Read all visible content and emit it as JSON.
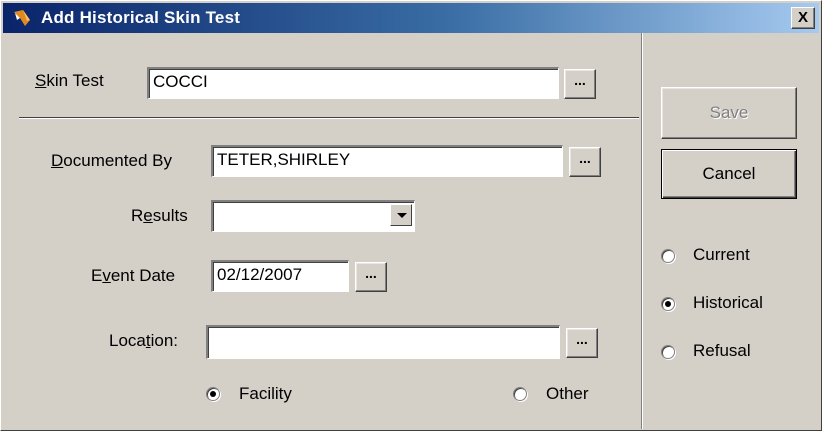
{
  "window": {
    "title": "Add Historical Skin Test",
    "close_label": "X"
  },
  "skin_test": {
    "label_underline": "S",
    "label_rest": "kin Test",
    "value": "COCCI",
    "lookup_label": "..."
  },
  "documented_by": {
    "label_underline": "D",
    "label_rest": "ocumented By",
    "value": "TETER,SHIRLEY",
    "lookup_label": "..."
  },
  "results": {
    "label_pre": "R",
    "label_underline": "e",
    "label_rest": "sults",
    "value": ""
  },
  "event_date": {
    "label_pre": "E",
    "label_underline": "v",
    "label_rest": "ent Date",
    "value": "02/12/2007",
    "picker_label": "..."
  },
  "location": {
    "label_pre": "Loca",
    "label_underline": "t",
    "label_rest": "ion:",
    "value": "",
    "lookup_label": "...",
    "options": [
      {
        "label": "Facility",
        "checked": true
      },
      {
        "label": "Other",
        "checked": false
      }
    ]
  },
  "actions": {
    "save_label": "Save",
    "save_enabled": false,
    "cancel_label": "Cancel"
  },
  "status_options": [
    {
      "label": "Current",
      "checked": false
    },
    {
      "label": "Historical",
      "checked": true
    },
    {
      "label": "Refusal",
      "checked": false
    }
  ]
}
